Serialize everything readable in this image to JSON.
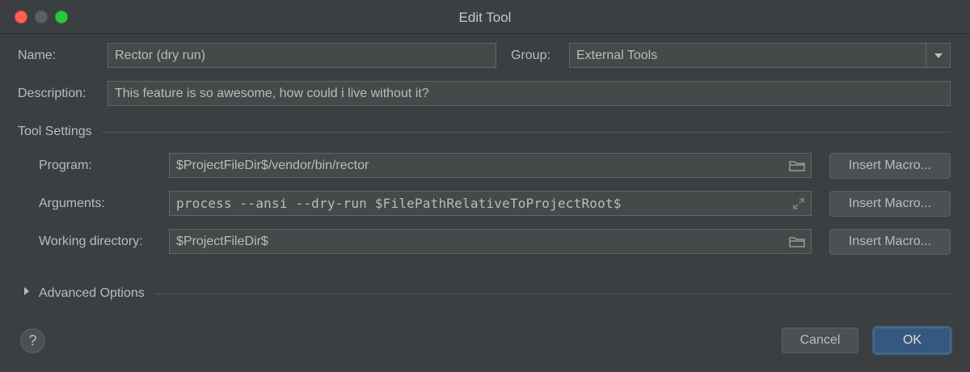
{
  "window": {
    "title": "Edit Tool"
  },
  "form": {
    "name_label": "Name:",
    "name_value": "Rector (dry run)",
    "group_label": "Group:",
    "group_value": "External Tools",
    "description_label": "Description:",
    "description_value": "This feature is so awesome, how could i live without it?"
  },
  "tool_settings": {
    "title": "Tool Settings",
    "program_label": "Program:",
    "program_value": "$ProjectFileDir$/vendor/bin/rector",
    "arguments_label": "Arguments:",
    "arguments_value": "process --ansi --dry-run $FilePathRelativeToProjectRoot$",
    "workdir_label": "Working directory:",
    "workdir_value": "$ProjectFileDir$",
    "insert_macro_label": "Insert Macro..."
  },
  "advanced": {
    "label": "Advanced Options"
  },
  "footer": {
    "help_label": "?",
    "cancel_label": "Cancel",
    "ok_label": "OK"
  },
  "colors": {
    "background": "#3c3f41",
    "field": "#45494a",
    "primary": "#365880",
    "close": "#ff5f57",
    "maximize": "#28c940"
  },
  "icons": [
    "folder-icon",
    "expand-icon",
    "disclosure-triangle-icon",
    "help-icon"
  ]
}
